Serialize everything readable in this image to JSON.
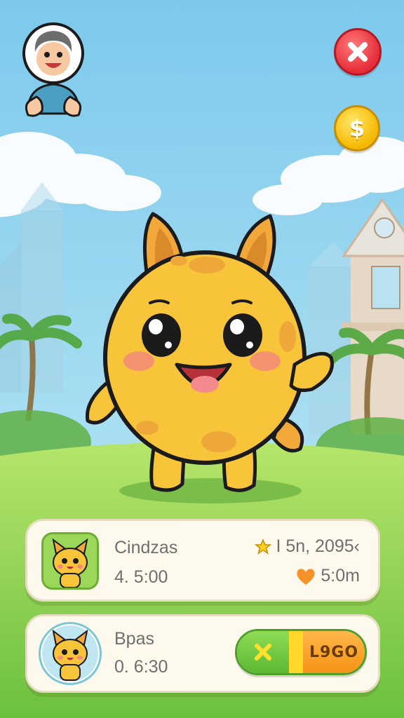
{
  "hud": {
    "avatar_icon": "player-avatar-icon",
    "close_icon": "close-x-icon",
    "coin_icon": "dollar-coin-icon",
    "coin_symbol": "$"
  },
  "cards": [
    {
      "thumb_icon": "fox-pet-icon",
      "name": "Cindzas",
      "time": "4. 5:00",
      "stat_top_icon": "star-icon",
      "stat_top": "I 5n, 2095‹",
      "stat_bottom_icon": "heart-icon",
      "stat_bottom": "5:0m"
    },
    {
      "thumb_icon": "fox-pet-icon",
      "name": "Bpas",
      "time": "0. 6:30",
      "action_icon": "x-mark-icon",
      "action_label": "L9GO"
    }
  ],
  "colors": {
    "sky": "#8fd3ee",
    "grass": "#8fd256",
    "pet_body": "#f8c43a",
    "close_red": "#e52c38",
    "coin_gold": "#f5b800",
    "card_bg": "#fdf9ec"
  }
}
